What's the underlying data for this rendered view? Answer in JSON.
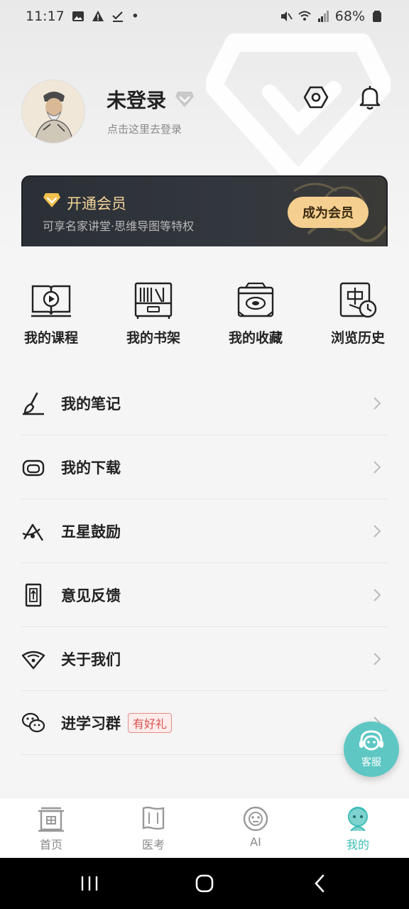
{
  "status_bar": {
    "time": "11:17",
    "dot": "•",
    "battery": "68%"
  },
  "profile": {
    "username": "未登录",
    "login_hint": "点击这里去登录"
  },
  "vip": {
    "title": "开通会员",
    "description": "可享名家讲堂·思维导图等特权",
    "button": "成为会员"
  },
  "quick_actions": [
    {
      "label": "我的课程",
      "icon": "course-book-icon"
    },
    {
      "label": "我的书架",
      "icon": "bookshelf-icon"
    },
    {
      "label": "我的收藏",
      "icon": "treasure-box-icon"
    },
    {
      "label": "浏览历史",
      "icon": "history-clock-icon"
    }
  ],
  "menu": [
    {
      "label": "我的笔记",
      "icon": "brush-icon"
    },
    {
      "label": "我的下载",
      "icon": "download-icon"
    },
    {
      "label": "五星鼓励",
      "icon": "star-icon"
    },
    {
      "label": "意见反馈",
      "icon": "feedback-icon"
    },
    {
      "label": "关于我们",
      "icon": "about-icon"
    },
    {
      "label": "进学习群",
      "icon": "wechat-icon",
      "badge": "有好礼"
    }
  ],
  "service": {
    "label": "客服"
  },
  "tabs": [
    {
      "label": "首页",
      "icon": "home-gate-icon",
      "active": false
    },
    {
      "label": "医考",
      "icon": "scroll-icon",
      "active": false
    },
    {
      "label": "AI",
      "icon": "ai-icon",
      "active": false
    },
    {
      "label": "我的",
      "icon": "profile-mascot-icon",
      "active": true
    }
  ],
  "colors": {
    "accent": "#3fbdb8",
    "vip_gold": "#f4cf8f",
    "vip_bg": "#2b2f36",
    "badge_red": "#d9534f"
  }
}
